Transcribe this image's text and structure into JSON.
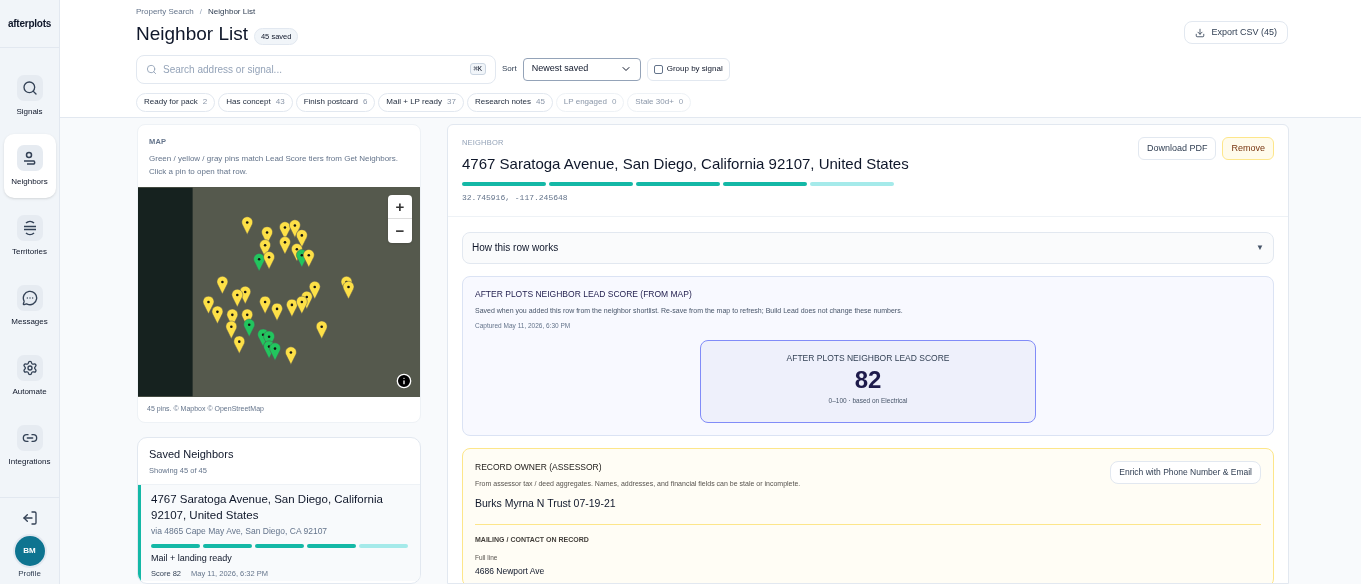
{
  "brand": {
    "name": "afterplots"
  },
  "nav": [
    {
      "label": "Signals",
      "selected": false
    },
    {
      "label": "Neighbors",
      "selected": true
    },
    {
      "label": "Territories",
      "selected": false
    },
    {
      "label": "Messages",
      "selected": false
    },
    {
      "label": "Automate",
      "selected": false
    },
    {
      "label": "Integrations",
      "selected": false
    }
  ],
  "profile": {
    "initials": "BM",
    "label": "Profile"
  },
  "breadcrumb": [
    "Property Search",
    "Neighbor List"
  ],
  "breadcrumb_separator": "/",
  "page": {
    "title": "Neighbor List",
    "badge": "45 saved",
    "export": "Export CSV (45)"
  },
  "search": {
    "placeholder": "Search address or signal...",
    "shortcut": "⌘K"
  },
  "sort": {
    "label": "Sort",
    "value": "Newest saved"
  },
  "group": {
    "label": "Group by signal",
    "checked": false
  },
  "filters": [
    {
      "label": "Ready for pack",
      "count": "2",
      "disabled": false
    },
    {
      "label": "Has concept",
      "count": "43",
      "disabled": false
    },
    {
      "label": "Finish postcard",
      "count": "6",
      "disabled": false
    },
    {
      "label": "Mail + LP ready",
      "count": "37",
      "disabled": false
    },
    {
      "label": "Research notes",
      "count": "45",
      "disabled": false
    },
    {
      "label": "LP engaged",
      "count": "0",
      "disabled": true
    },
    {
      "label": "Stale 30d+",
      "count": "0",
      "disabled": true
    }
  ],
  "map": {
    "heading": "MAP",
    "description": "Green / yellow / gray pins match Lead Score tiers from Get Neighbors. Click a pin to open that row.",
    "zoom_in": "+",
    "zoom_out": "−",
    "footer": "45 pins. © Mapbox © OpenStreetMap"
  },
  "saved": {
    "title": "Saved Neighbors",
    "subtitle": "Showing 45 of 45",
    "rows": [
      {
        "address": "4767 Saratoga Avenue, San Diego, California 92107, United States",
        "via": "via 4865 Cape May Ave, San Diego, CA 92107",
        "level": 0.8,
        "status": "Mail + landing ready",
        "score": "Score 82",
        "date": "May 11, 2026, 6:32 PM",
        "selected": true
      }
    ]
  },
  "detail": {
    "eyebrow": "NEIGHBOR",
    "address": "4767 Saratoga Avenue, San Diego, California 92107, United States",
    "level": 0.8,
    "coords": "32.745916, -117.245648",
    "buttons": [
      {
        "label": "Download PDF",
        "kind": "default"
      },
      {
        "label": "Remove",
        "kind": "warning"
      }
    ],
    "accordion": {
      "label": "How this row works",
      "expanded": false,
      "caret": "▼"
    },
    "lead": {
      "heading": "AFTER PLOTS NEIGHBOR LEAD SCORE (FROM MAP)",
      "note": "Saved when you added this row from the neighbor shortlist. Re-save from the map to refresh; Build Lead does not change these numbers.",
      "captured": "Captured May 11, 2026, 6:30 PM",
      "score_label": "AFTER PLOTS NEIGHBOR LEAD SCORE",
      "score": "82",
      "score_note": "0–100 · based on Electrical"
    },
    "owner": {
      "heading": "RECORD OWNER (ASSESSOR)",
      "note": "From assessor tax / deed aggregates. Names, addresses, and financial fields can be stale or incomplete.",
      "enrich": "Enrich with Phone Number & Email",
      "name": "Burks Myrna N Trust 07-19-21",
      "mailing_heading": "MAILING / CONTACT ON RECORD",
      "fields": [
        {
          "label": "Full line",
          "value": "4686 Newport Ave"
        }
      ]
    }
  }
}
